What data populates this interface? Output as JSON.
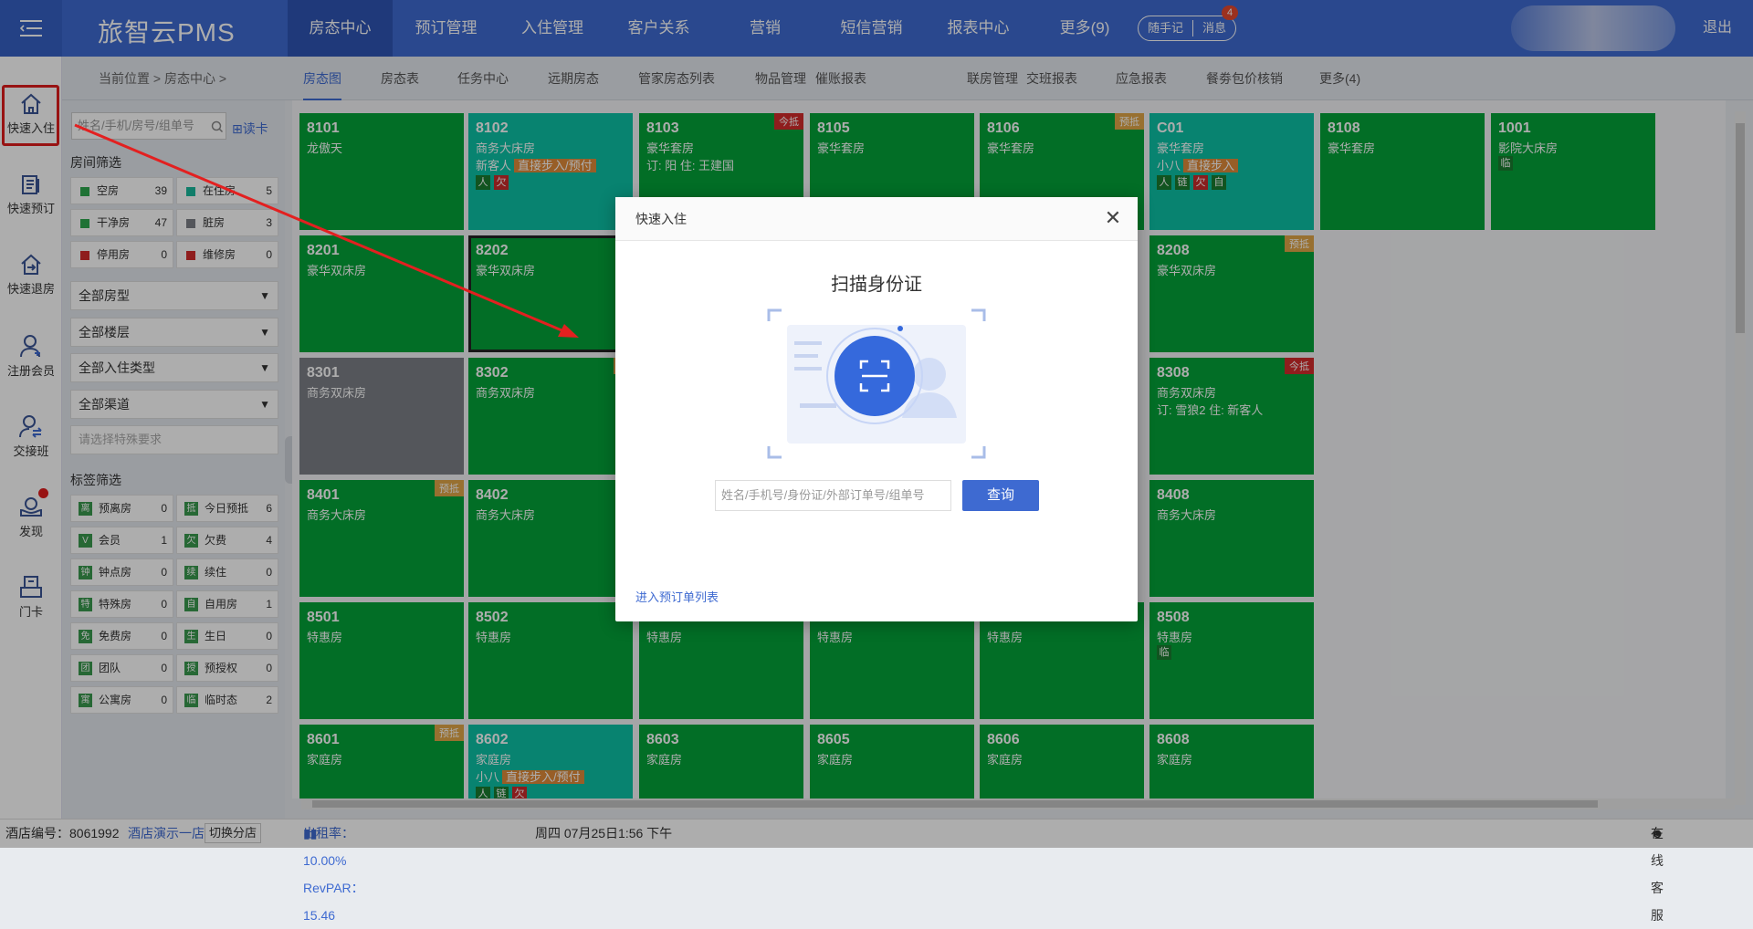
{
  "app": {
    "logo": "旅智云PMS",
    "nav": [
      "房态中心",
      "预订管理",
      "入住管理",
      "客户关系",
      "营销",
      "短信营销",
      "报表中心",
      "更多(9)"
    ],
    "note_label": "随手记",
    "msg_label": "消息",
    "msg_count": "4",
    "logout": "退出"
  },
  "leftnav": {
    "items": [
      "快速入住",
      "快速预订",
      "快速退房",
      "注册会员",
      "交接班",
      "发现",
      "门卡"
    ]
  },
  "subnav": {
    "breadcrumb": "当前位置 > 房态中心 >",
    "tabs": [
      "房态图",
      "房态表",
      "任务中心",
      "远期房态",
      "管家房态列表",
      "物品管理",
      "催账报表",
      "联房管理",
      "交班报表",
      "应急报表",
      "餐劵包价核销",
      "更多(4)"
    ]
  },
  "filter": {
    "search_placeholder": "姓名/手机/房号/组单号",
    "read_card": "读卡",
    "room_filter_title": "房间筛选",
    "status": [
      {
        "label": "空房",
        "count": "39",
        "color": "#2fa84f"
      },
      {
        "label": "在住房",
        "count": "5",
        "color": "#18b89d"
      },
      {
        "label": "干净房",
        "count": "47",
        "color": "#2fa84f"
      },
      {
        "label": "脏房",
        "count": "3",
        "color": "#7c7f86"
      },
      {
        "label": "停用房",
        "count": "0",
        "color": "#d32b2b"
      },
      {
        "label": "维修房",
        "count": "0",
        "color": "#d32b2b"
      }
    ],
    "selects": [
      "全部房型",
      "全部楼层",
      "全部入住类型",
      "全部渠道"
    ],
    "special_placeholder": "请选择特殊要求",
    "tag_filter_title": "标签筛选",
    "tags": [
      {
        "icon": "离",
        "label": "预离房",
        "count": "0"
      },
      {
        "icon": "抵",
        "label": "今日预抵",
        "count": "6"
      },
      {
        "icon": "V",
        "label": "会员",
        "count": "1"
      },
      {
        "icon": "欠",
        "label": "欠费",
        "count": "4"
      },
      {
        "icon": "钟",
        "label": "钟点房",
        "count": "0"
      },
      {
        "icon": "续",
        "label": "续住",
        "count": "0"
      },
      {
        "icon": "特",
        "label": "特殊房",
        "count": "0"
      },
      {
        "icon": "自",
        "label": "自用房",
        "count": "1"
      },
      {
        "icon": "免",
        "label": "免费房",
        "count": "0"
      },
      {
        "icon": "生",
        "label": "生日",
        "count": "0"
      },
      {
        "icon": "团",
        "label": "团队",
        "count": "0"
      },
      {
        "icon": "授",
        "label": "预授权",
        "count": "0"
      },
      {
        "icon": "寓",
        "label": "公寓房",
        "count": "0"
      },
      {
        "icon": "临",
        "label": "临时态",
        "count": "2"
      }
    ]
  },
  "rooms": [
    {
      "no": "8101",
      "type": "龙傲天",
      "color": "green"
    },
    {
      "no": "8102",
      "type": "商务大床房",
      "color": "cyan",
      "guest": "新客人",
      "tag": "直接步入/预付",
      "icons": [
        "人",
        "欠"
      ]
    },
    {
      "no": "8103",
      "type": "豪华套房",
      "color": "green",
      "flag": "今抵",
      "line3": "订: 阳 住: 王建国"
    },
    {
      "no": "8105",
      "type": "豪华套房",
      "color": "green"
    },
    {
      "no": "8106",
      "type": "豪华套房",
      "color": "green",
      "flag": "预抵"
    },
    {
      "no": "C01",
      "type": "豪华套房",
      "color": "cyan",
      "guest": "小八",
      "tag": "直接步入",
      "icons": [
        "人",
        "链",
        "欠",
        "自"
      ]
    },
    {
      "no": "8108",
      "type": "豪华套房",
      "color": "green"
    },
    {
      "no": "1001",
      "type": "影院大床房",
      "color": "green",
      "icons": [
        "临"
      ]
    },
    {
      "no": "8201",
      "type": "豪华双床房",
      "color": "green"
    },
    {
      "no": "8202",
      "type": "豪华双床房",
      "color": "green",
      "selected": true
    },
    {
      "no": "8208",
      "type": "豪华双床房",
      "color": "green",
      "flag": "预抵"
    },
    {
      "no": "8301",
      "type": "商务双床房",
      "color": "gray"
    },
    {
      "no": "8302",
      "type": "商务双床房",
      "color": "green",
      "flag": "预"
    },
    {
      "no": "8308",
      "type": "商务双床房",
      "color": "green",
      "flag": "今抵",
      "line3": "订: 雪狼2 住: 新客人"
    },
    {
      "no": "8401",
      "type": "商务大床房",
      "color": "green",
      "flag": "预抵"
    },
    {
      "no": "8402",
      "type": "商务大床房",
      "color": "green"
    },
    {
      "no": "8408",
      "type": "商务大床房",
      "color": "green"
    },
    {
      "no": "8501",
      "type": "特惠房",
      "color": "green"
    },
    {
      "no": "8502",
      "type": "特惠房",
      "color": "green"
    },
    {
      "no": "",
      "type": "特惠房",
      "color": "green"
    },
    {
      "no": "",
      "type": "特惠房",
      "color": "green"
    },
    {
      "no": "",
      "type": "特惠房",
      "color": "green"
    },
    {
      "no": "8508",
      "type": "特惠房",
      "color": "green",
      "icons": [
        "临"
      ]
    },
    {
      "no": "8601",
      "type": "家庭房",
      "color": "green",
      "flag": "预抵"
    },
    {
      "no": "8602",
      "type": "家庭房",
      "color": "cyan",
      "guest": "小八",
      "tag": "直接步入/预付",
      "icons": [
        "人",
        "链",
        "欠"
      ]
    },
    {
      "no": "8603",
      "type": "家庭房",
      "color": "green"
    },
    {
      "no": "8605",
      "type": "家庭房",
      "color": "green"
    },
    {
      "no": "8606",
      "type": "家庭房",
      "color": "green"
    },
    {
      "no": "8608",
      "type": "家庭房",
      "color": "green"
    }
  ],
  "modal": {
    "title": "快速入住",
    "scan_title": "扫描身份证",
    "query_placeholder": "姓名/手机号/身份证/外部订单号/组单号",
    "query_button": "查询",
    "goto_list": "进入预订单列表"
  },
  "footer": {
    "hotel_label": "酒店编号：8061992",
    "hotel_name": "酒店演示一店",
    "switch": "切换分店",
    "stats": "出租率：10.00% RevPAR：15.46",
    "datetime": "周四 07月25日1:56 下午",
    "online_service": "在线客服"
  },
  "colors": {
    "brand": "#3e6ad1",
    "room_green": "#04a239",
    "room_cyan": "#0dc1a5",
    "room_gray": "#7c7f86",
    "highlight_red": "#e01c1c"
  }
}
